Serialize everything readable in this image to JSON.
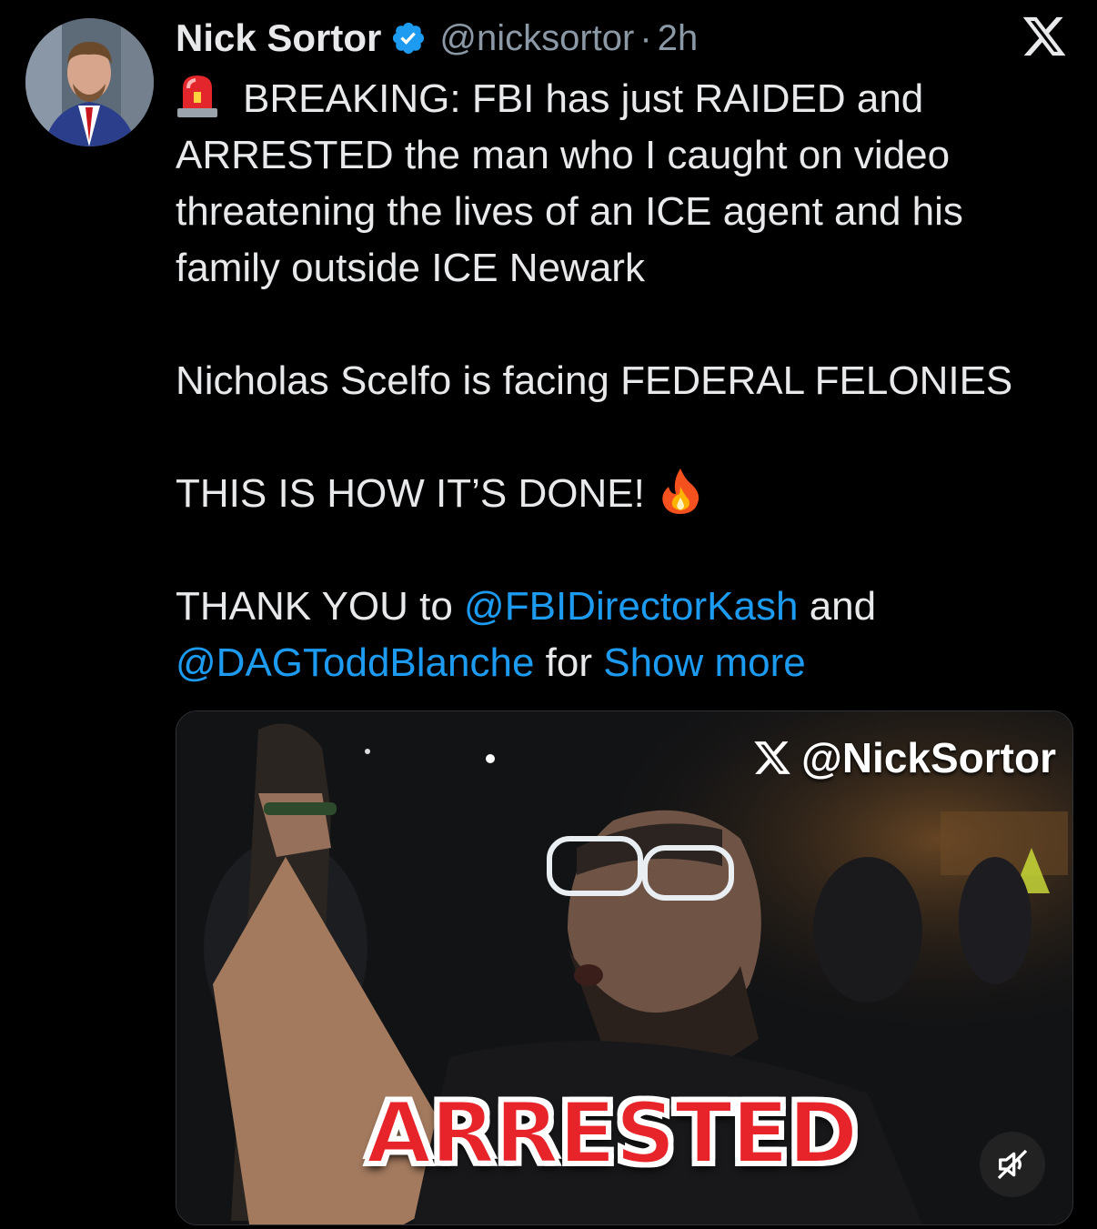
{
  "tweet": {
    "author_name": "Nick Sortor",
    "handle": "@nicksortor",
    "separator": "·",
    "time": "2h",
    "line1": "BREAKING: FBI has just RAIDED and ARRESTED the man who I caught on video threatening the lives of an ICE agent and his family outside ICE Newark",
    "line2": "Nicholas Scelfo is facing FEDERAL FELONIES",
    "line3": "THIS IS HOW IT’S DONE!",
    "line4_prefix": "THANK YOU to ",
    "mention1": "@FBIDirectorKash",
    "line4_mid": " and",
    "mention2": "@DAGToddBlanche",
    "line4_suffix": " for ",
    "show_more": "Show more"
  },
  "media": {
    "watermark": "@NickSortor",
    "overlay_text": "ARRESTED"
  },
  "icons": {
    "verified": "verified-badge-icon",
    "x_logo": "x-logo-icon",
    "siren": "police-siren-emoji",
    "fire": "fire-emoji",
    "mute": "muted-speaker-icon"
  },
  "colors": {
    "background": "#000000",
    "text": "#e7e9ea",
    "secondary": "#8b98a5",
    "link": "#1d9bf0",
    "badge": "#1d9bf0",
    "overlay_red": "#e8242b"
  }
}
